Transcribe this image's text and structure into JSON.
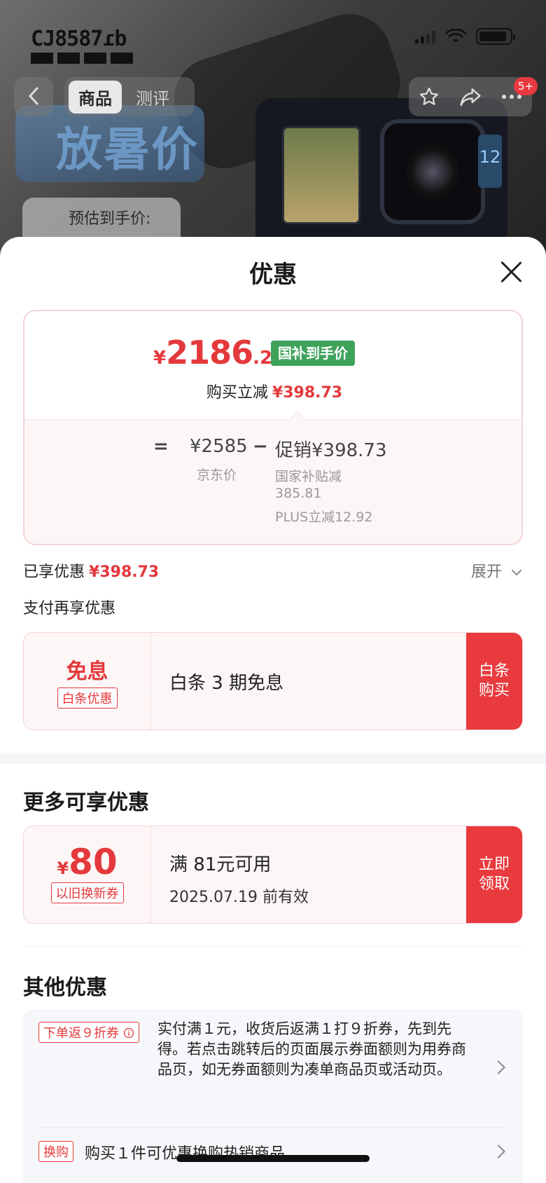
{
  "status_bar": {
    "carrier_logo": "CJ8587 ■■■■",
    "icons": [
      "signal-icon",
      "wifi-icon",
      "battery-icon"
    ]
  },
  "background_page": {
    "tabs": [
      {
        "label": "商品",
        "active": true
      },
      {
        "label": "测评",
        "active": false
      }
    ],
    "banner_text": "放暑价",
    "estimate_label": "预估到手价:",
    "notification_badge": "5+"
  },
  "sheet": {
    "title": "优惠",
    "price_card": {
      "currency": "¥",
      "price_int": "2186",
      "price_dec": ".27",
      "tag": "国补到手价",
      "buy_reduce_label": "购买立减",
      "buy_reduce_value": "¥398.73",
      "eq": "=",
      "jd_price": "¥2585",
      "jd_label": "京东价",
      "minus": "−",
      "promo": "促销¥398.73",
      "national_subsidy_label": "国家补贴减",
      "national_subsidy_value": "385.81",
      "plus_label": "PLUS立减12.92"
    },
    "enjoyed_label": "已享优惠",
    "enjoyed_value": "¥398.73",
    "expand_label": "展开",
    "pay_more_label": "支付再享优惠",
    "baitiao_coupon": {
      "title": "免息",
      "tag": "白条优惠",
      "desc": "白条 3 期免息",
      "cta": "白条\n购买"
    },
    "more_section_title": "更多可享优惠",
    "trade_in_coupon": {
      "currency": "¥",
      "amount": "80",
      "tag": "以旧换新券",
      "condition": "满 81元可用",
      "expiry": "2025.07.19 前有效",
      "cta": "立即\n领取"
    },
    "other_section_title": "其他优惠",
    "other_items": [
      {
        "tag": "下单返９折券",
        "text": "实付满１元，收货后返满１打９折券，先到先得。若点击跳转后的页面展示券面额则为用券商品页，如无券面额则为凑单商品页或活动页。"
      },
      {
        "tag": "换购",
        "text": "购买１件可优惠换购热销商品"
      }
    ]
  },
  "colors": {
    "accent_red": "#e4393c",
    "subsidy_green": "#3fa25b",
    "card_border": "#f4d3d5"
  }
}
